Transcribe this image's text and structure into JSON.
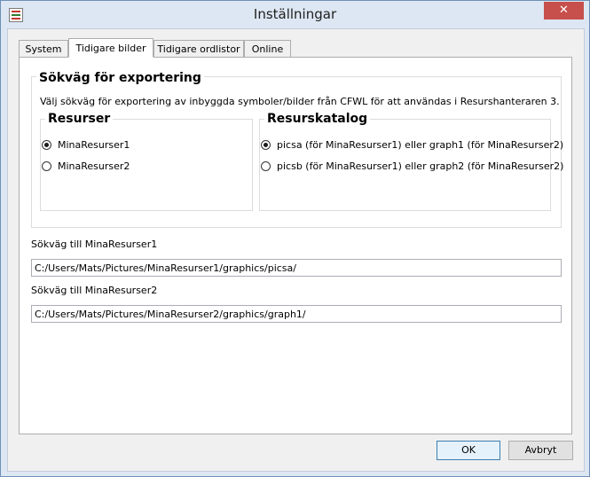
{
  "window": {
    "title": "Inställningar",
    "close_label": "✕"
  },
  "tabs": [
    {
      "label": "System"
    },
    {
      "label": "Tidigare bilder"
    },
    {
      "label": "Tidigare ordlistor"
    },
    {
      "label": "Online"
    }
  ],
  "export_group": {
    "title": "Sökväg för exportering",
    "description": "Välj sökväg för exportering av inbyggda symboler/bilder från CFWL för att användas i Resurshanteraren 3."
  },
  "resources_group": {
    "title": "Resurser",
    "options": [
      {
        "label": "MinaResurser1",
        "selected": true
      },
      {
        "label": "MinaResurser2",
        "selected": false
      }
    ]
  },
  "catalog_group": {
    "title": "Resurskatalog",
    "options": [
      {
        "label": "picsa (för MinaResurser1) eller graph1 (för MinaResurser2)",
        "selected": true
      },
      {
        "label": "picsb (för MinaResurser1) eller graph2 (för MinaResurser2)",
        "selected": false
      }
    ]
  },
  "path1": {
    "label": "Sökväg till MinaResurser1",
    "value": "C:/Users/Mats/Pictures/MinaResurser1/graphics/picsa/"
  },
  "path2": {
    "label": "Sökväg till MinaResurser2",
    "value": "C:/Users/Mats/Pictures/MinaResurser2/graphics/graph1/"
  },
  "buttons": {
    "ok_label": "OK",
    "cancel_label": "Avbryt"
  }
}
